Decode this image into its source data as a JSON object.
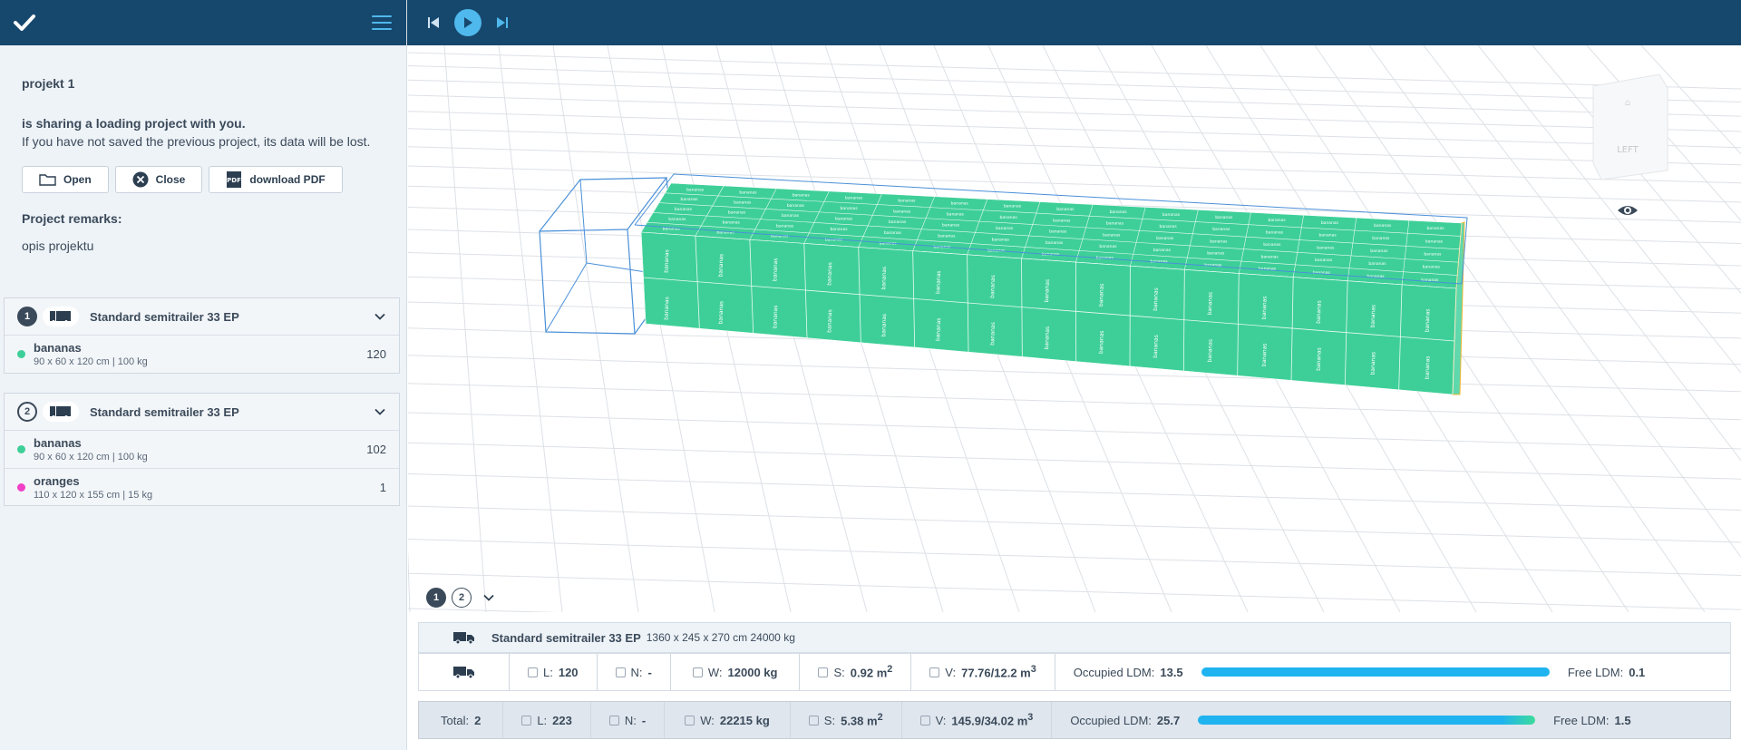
{
  "topbar": {
    "prev_icon": "skip-previous-icon",
    "play_icon": "play-icon",
    "next_icon": "skip-next-icon"
  },
  "sidebar": {
    "logo_icon": "checkmark-logo-icon",
    "menu_icon": "hamburger-menu-icon",
    "project_name": "projekt 1",
    "share_title": "is sharing a loading project with you.",
    "share_text": "If you have not saved the previous project, its data will be lost.",
    "buttons": [
      {
        "label": "Open",
        "icon": "folder-icon"
      },
      {
        "label": "Close",
        "icon": "close-circle-icon"
      },
      {
        "label": "download PDF",
        "icon": "pdf-icon"
      }
    ],
    "remarks_label": "Project remarks:",
    "remarks_text": "opis projektu",
    "trucks": [
      {
        "number": "1",
        "name": "Standard semitrailer 33 EP",
        "cargo": [
          {
            "name": "bananas",
            "dims": "90 x 60 x 120 cm | 100 kg",
            "count": "120",
            "color": "#3ecf98"
          }
        ]
      },
      {
        "number": "2",
        "name": "Standard semitrailer 33 EP",
        "cargo": [
          {
            "name": "bananas",
            "dims": "90 x 60 x 120 cm | 100 kg",
            "count": "102",
            "color": "#3ecf98"
          },
          {
            "name": "oranges",
            "dims": "110 x 120 x 155 cm | 15 kg",
            "count": "1",
            "color": "#f040c8"
          }
        ]
      }
    ]
  },
  "viewport": {
    "cube_face_label": "LEFT",
    "eye_icon": "eye-icon",
    "box_label": "bananas",
    "box_color": "#3ecf98",
    "truck_tabs": [
      "1",
      "2"
    ]
  },
  "truck_info": {
    "name": "Standard semitrailer 33 EP",
    "dims": "1360 x 245 x 270 cm 24000 kg"
  },
  "truck_stats": {
    "L_label": "L:",
    "L": "120",
    "N_label": "N:",
    "N": "-",
    "W_label": "W:",
    "W": "12000 kg",
    "S_label": "S:",
    "S": "0.92 m",
    "V_label": "V:",
    "V": "77.76/12.2 m",
    "occupied_label": "Occupied LDM:",
    "occupied": "13.5",
    "free_label": "Free LDM:",
    "free": "0.1",
    "ldm_fill": 0.99
  },
  "total_stats": {
    "total_label": "Total:",
    "total": "2",
    "L_label": "L:",
    "L": "223",
    "N_label": "N:",
    "N": "-",
    "W_label": "W:",
    "W": "22215 kg",
    "S_label": "S:",
    "S": "5.38 m",
    "V_label": "V:",
    "V": "145.9/34.02 m",
    "occupied_label": "Occupied LDM:",
    "occupied": "25.7",
    "free_label": "Free LDM:",
    "free": "1.5",
    "ldm_fill": 0.94
  },
  "units": {
    "area_sup": "2",
    "volume_sup": "3"
  }
}
